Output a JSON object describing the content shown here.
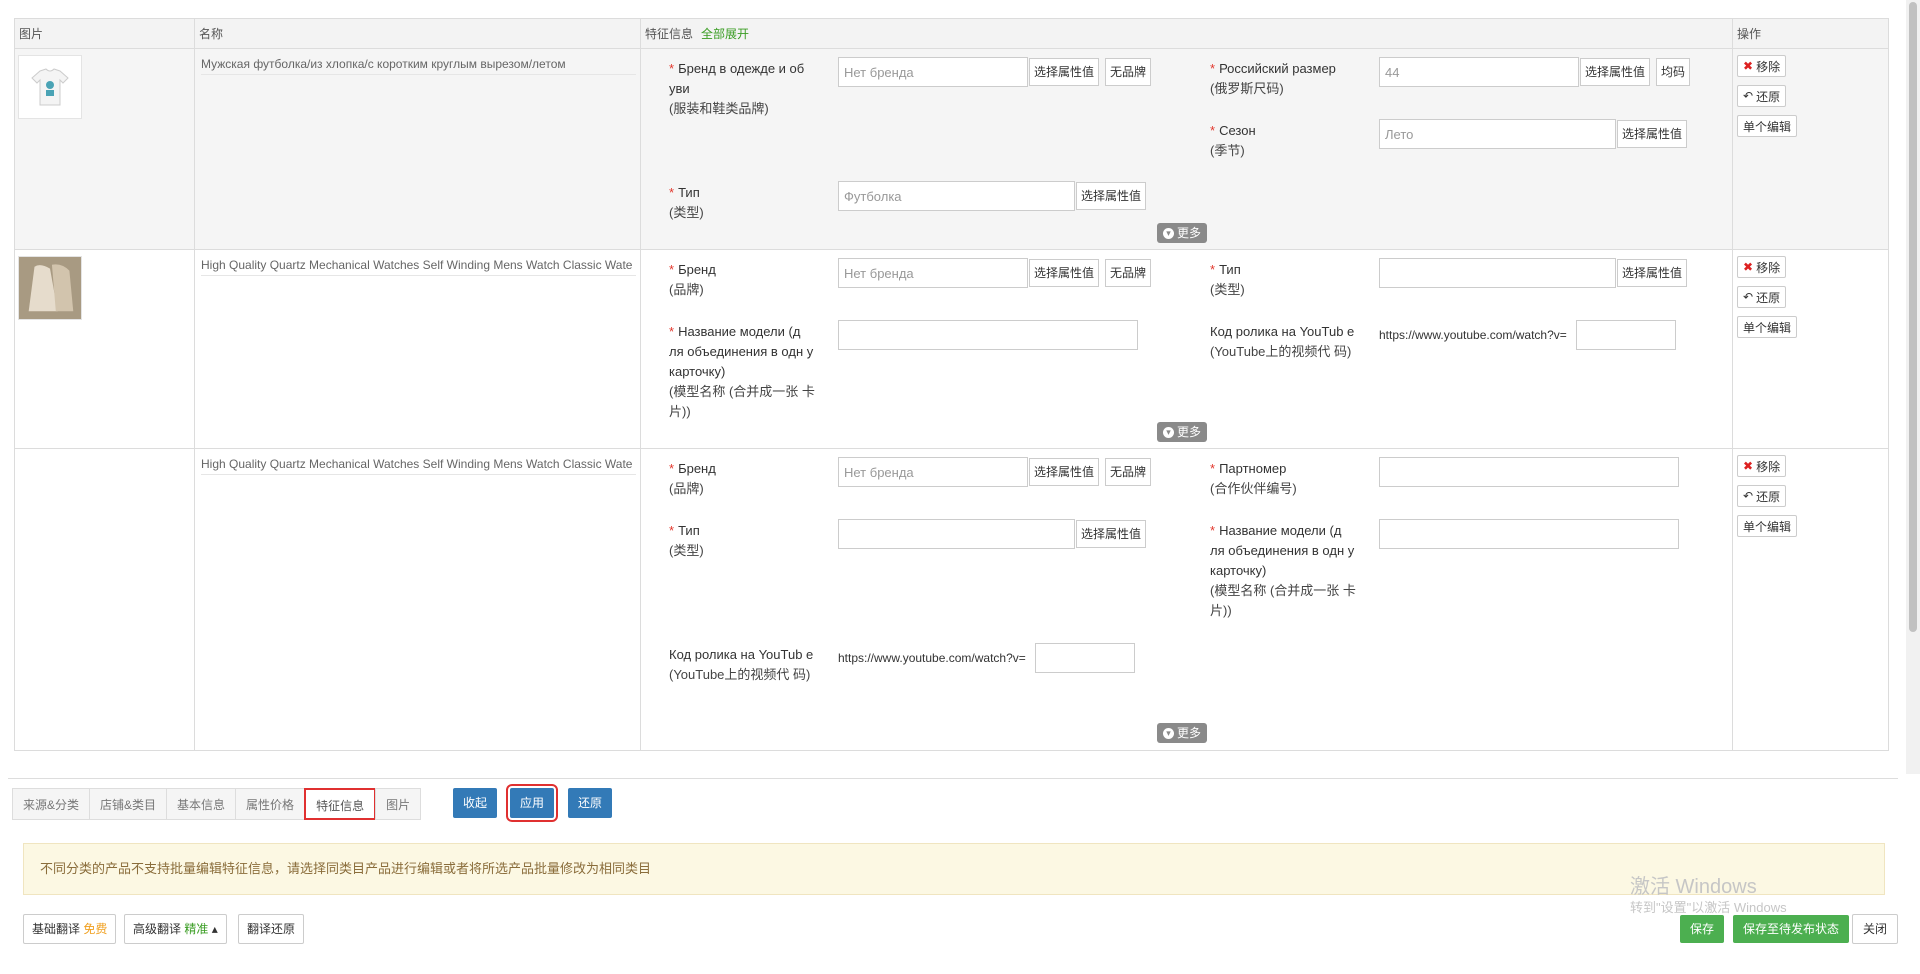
{
  "table": {
    "headers": {
      "image": "图片",
      "name": "名称",
      "attrs": "特征信息",
      "expand_all": "全部展开",
      "ops": "操作"
    },
    "rows": [
      {
        "name": "Мужская футболка/из хлопка/с коротким круглым вырезом/летом",
        "attrs": {
          "brand": {
            "label": "Бренд в одежде и об уви",
            "cn": "(服装和鞋类品牌)",
            "value": "Нет бренда",
            "btn1": "选择属性值",
            "btn2": "无品牌"
          },
          "size": {
            "label": "Российский размер",
            "cn": "(俄罗斯尺码)",
            "value": "44",
            "btn1": "选择属性值",
            "btn2": "均码"
          },
          "season": {
            "label": "Сезон",
            "cn": "(季节)",
            "value": "Лето",
            "btn1": "选择属性值"
          },
          "type": {
            "label": "Тип",
            "cn": "(类型)",
            "value": "Футболка",
            "btn1": "选择属性值"
          }
        },
        "more": "更多"
      },
      {
        "name": "High Quality Quartz Mechanical Watches Self Winding Mens Watch Classic Wate",
        "attrs": {
          "brand": {
            "label": "Бренд",
            "cn": "(品牌)",
            "value": "Нет бренда",
            "btn1": "选择属性值",
            "btn2": "无品牌"
          },
          "type": {
            "label": "Тип",
            "cn": "(类型)",
            "value": "",
            "btn1": "选择属性值"
          },
          "model": {
            "label": "Название модели (д ля объединения в одн у карточку)",
            "cn": "(模型名称 (合并成一张 卡片))",
            "value": ""
          },
          "youtube": {
            "label": "Код ролика на YouTub e",
            "cn": "(YouTube上的视频代 码)",
            "url": "https://www.youtube.com/watch?v=",
            "value": ""
          }
        },
        "more": "更多"
      },
      {
        "name": "High Quality Quartz Mechanical Watches Self Winding Mens Watch Classic Wate",
        "attrs": {
          "brand": {
            "label": "Бренд",
            "cn": "(品牌)",
            "value": "Нет бренда",
            "btn1": "选择属性值",
            "btn2": "无品牌"
          },
          "partnumber": {
            "label": "Партномер",
            "cn": "(合作伙伴编号)",
            "value": ""
          },
          "type": {
            "label": "Тип",
            "cn": "(类型)",
            "value": "",
            "btn1": "选择属性值"
          },
          "model": {
            "label": "Название модели (д ля объединения в одн у карточку)",
            "cn": "(模型名称 (合并成一张 卡片))",
            "value": ""
          },
          "youtube": {
            "label": "Код ролика на YouTub e",
            "cn": "(YouTube上的视频代 码)",
            "url": "https://www.youtube.com/watch?v=",
            "value": ""
          }
        },
        "more": "更多"
      }
    ],
    "ops": {
      "remove": "移除",
      "restore": "还原",
      "single_edit": "单个编辑"
    }
  },
  "bottom": {
    "tabs": [
      "来源&分类",
      "店铺&类目",
      "基本信息",
      "属性价格",
      "特征信息",
      "图片"
    ],
    "active_tab": "特征信息",
    "actions": {
      "collapse": "收起",
      "apply": "应用",
      "restore": "还原"
    },
    "notice": "不同分类的产品不支持批量编辑特征信息，请选择同类目产品进行编辑或者将所选产品批量修改为相同类目",
    "tools": {
      "basic_translate": "基础翻译",
      "basic_tag": "免费",
      "adv_translate": "高级翻译",
      "adv_tag": "精准",
      "translate_restore": "翻译还原"
    },
    "save": "保存",
    "save_pending": "保存至待发布状态",
    "close": "关闭"
  },
  "watermark": {
    "line1": "激活 Windows",
    "line2": "转到\"设置\"以激活 Windows"
  },
  "colors": {
    "green": "#4caf50",
    "blue": "#337ab7",
    "red_outline": "#e03030",
    "required": "#e2372c"
  }
}
